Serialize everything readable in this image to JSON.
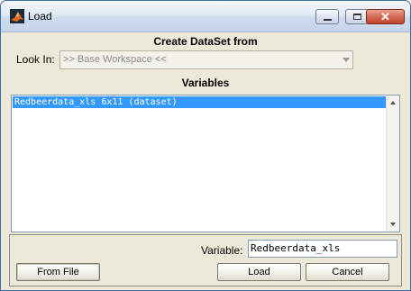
{
  "window": {
    "title": "Load"
  },
  "header": {
    "title": "Create DataSet from"
  },
  "look_in": {
    "label": "Look In:",
    "value": ">> Base Workspace <<"
  },
  "variables": {
    "heading": "Variables",
    "items": [
      {
        "text": "Redbeerdata_xls 6x11 (dataset)",
        "selected": true
      }
    ]
  },
  "variable_field": {
    "label": "Variable:",
    "value": "Redbeerdata_xls"
  },
  "buttons": {
    "from_file": "From File",
    "load": "Load",
    "cancel": "Cancel"
  },
  "colors": {
    "selection": "#3399ff",
    "dialog_bg": "#ece9d8",
    "icon": "matlab-logo-icon"
  }
}
